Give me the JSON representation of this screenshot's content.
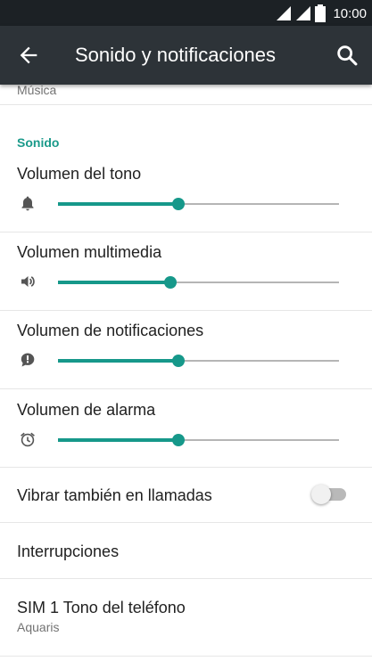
{
  "status_bar": {
    "time": "10:00"
  },
  "app_bar": {
    "title": "Sonido y notificaciones"
  },
  "partial_item": {
    "label": "Música"
  },
  "section": {
    "title": "Sonido"
  },
  "volumes": [
    {
      "label": "Volumen del tono",
      "icon": "bell-icon",
      "level": 0.43
    },
    {
      "label": "Volumen multimedia",
      "icon": "speaker-icon",
      "level": 0.4
    },
    {
      "label": "Volumen de notificaciones",
      "icon": "notification-icon",
      "level": 0.43
    },
    {
      "label": "Volumen de alarma",
      "icon": "alarm-clock-icon",
      "level": 0.43
    }
  ],
  "vibrate": {
    "label": "Vibrar también en llamadas",
    "enabled": false
  },
  "interruptions": {
    "label": "Interrupciones"
  },
  "ringtone": {
    "label": "SIM 1 Tono del teléfono",
    "value": "Aquaris"
  },
  "colors": {
    "accent": "#16988a",
    "app_bar": "#2d3338",
    "status_bar": "#1c2125"
  }
}
